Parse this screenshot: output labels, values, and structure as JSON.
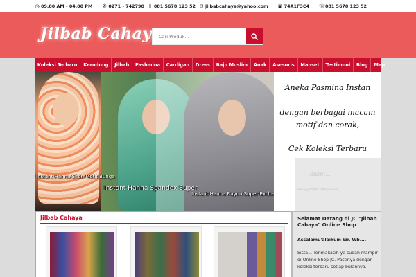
{
  "topbar": {
    "hours": "09.00 AM - 04.00 PM",
    "phone": "0271 - 742790",
    "mobile": "081 5678 123 52",
    "email": "jilbabcahaya@yahoo.com",
    "bbm": "74A1F3C4",
    "whatsapp": "081 5678 123 52"
  },
  "header": {
    "logo": "Jilbab Cahaya",
    "search_placeholder": "Cari Produk..."
  },
  "nav": {
    "items": [
      "Koleksi Terbaru",
      "Kerudung",
      "Jilbab",
      "Pashmina",
      "Cardigan",
      "Dress",
      "Baju Muslim",
      "Anak",
      "Asesoris",
      "Manset",
      "Testimoni",
      "Blog",
      "Map"
    ]
  },
  "slider": {
    "captions": [
      "Instant Hanna Sifon Motif Bunga",
      "Instant Hanna Spandex Super",
      "Instant Hanna Rayon Super Exclusive"
    ]
  },
  "promo": {
    "line1": "Aneka Pasmina Instan",
    "line2": "dengan berbagai macam",
    "line3": "motif dan corak,",
    "line4": "Cek Koleksi Terbaru",
    "placeholder": "disini...",
    "watermark": "www.JilbabCahaya.com"
  },
  "content": {
    "title": "Jilbab Cahaya"
  },
  "sidebar": {
    "heading": "Selamat Datang di JC \"Jilbab Cahaya\" Online Shop",
    "salam": "Assalamu'alaikum Wr. Wb....",
    "body": "Sista... Terimakasih ya sudah mampir di Online Shop JC. Pastinya dengan koleksi terbaru setiap bulannya.."
  },
  "colors": {
    "header_bg": "#ec5b5b",
    "nav_bg": "#c8102e",
    "accent": "#c8102e"
  }
}
